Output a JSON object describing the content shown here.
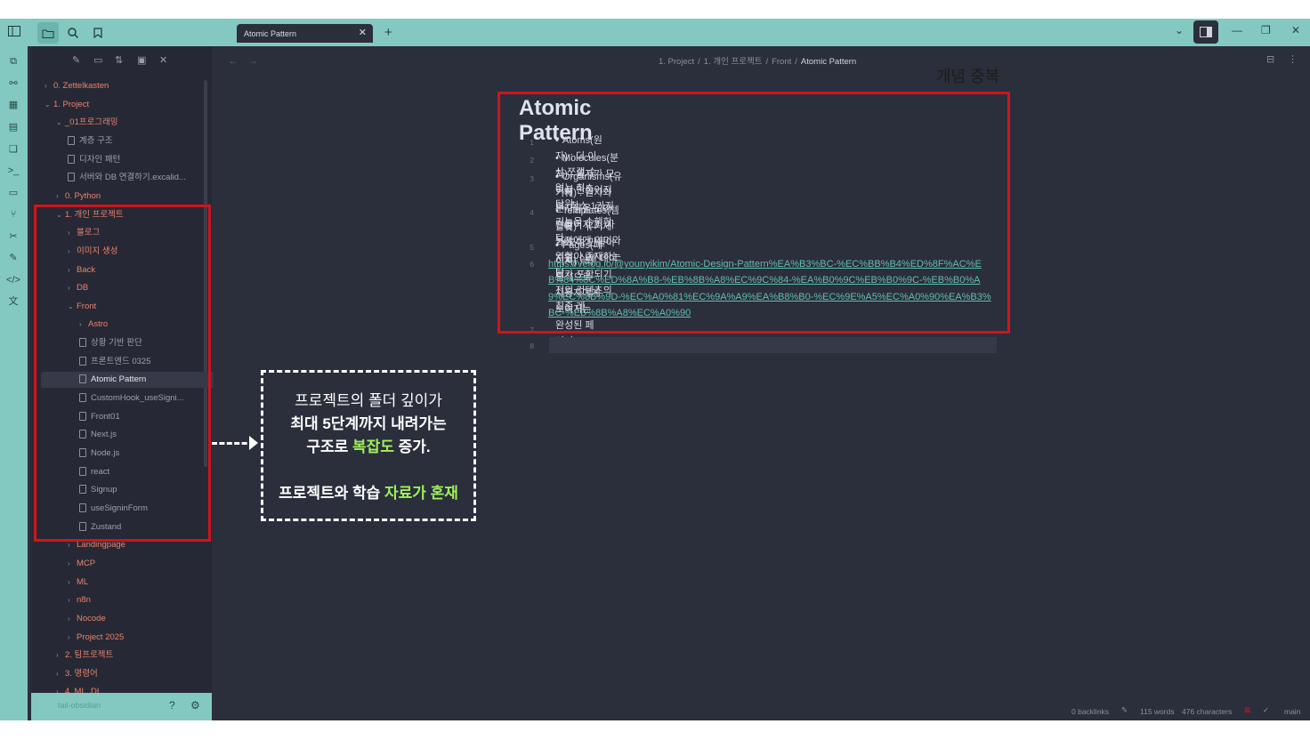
{
  "titlebar": {
    "tab_title": "Atomic Pattern",
    "tab_close": "✕",
    "new_tab": "+"
  },
  "breadcrumb": [
    "1. Project",
    "1. 개인 프로젝트",
    "Front",
    "Atomic Pattern"
  ],
  "sidebar": {
    "vault_name": "tail-obsidian",
    "items": [
      {
        "label": "0. Zettelkasten",
        "kind": "folder",
        "open": false,
        "depth": 1
      },
      {
        "label": "1. Project",
        "kind": "folder",
        "open": true,
        "depth": 1
      },
      {
        "label": "_01프로그래밍",
        "kind": "folder",
        "open": true,
        "depth": 2
      },
      {
        "label": "계층 구조",
        "kind": "file",
        "depth": 3
      },
      {
        "label": "디자인 패턴",
        "kind": "file",
        "depth": 3
      },
      {
        "label": "서버와 DB 연결하기.excalid...",
        "kind": "file",
        "depth": 3
      },
      {
        "label": "0. Python",
        "kind": "folder",
        "open": false,
        "depth": 2
      },
      {
        "label": "1. 개인 프로젝트",
        "kind": "folder",
        "open": true,
        "depth": 2
      },
      {
        "label": "블로그",
        "kind": "folder",
        "open": false,
        "depth": 3
      },
      {
        "label": "이미지 생성",
        "kind": "folder",
        "open": false,
        "depth": 3
      },
      {
        "label": "Back",
        "kind": "folder",
        "open": false,
        "depth": 3
      },
      {
        "label": "DB",
        "kind": "folder",
        "open": false,
        "depth": 3
      },
      {
        "label": "Front",
        "kind": "folder",
        "open": true,
        "depth": 3
      },
      {
        "label": "Astro",
        "kind": "folder",
        "open": false,
        "depth": 4
      },
      {
        "label": "상황 기반 판단",
        "kind": "file",
        "depth": 4
      },
      {
        "label": "프론트엔드 0325",
        "kind": "file",
        "depth": 4
      },
      {
        "label": "Atomic Pattern",
        "kind": "file",
        "depth": 4,
        "selected": true
      },
      {
        "label": "CustomHook_useSigni...",
        "kind": "file",
        "depth": 4
      },
      {
        "label": "Front01",
        "kind": "file",
        "depth": 4
      },
      {
        "label": "Next.js",
        "kind": "file",
        "depth": 4
      },
      {
        "label": "Node.js",
        "kind": "file",
        "depth": 4
      },
      {
        "label": "react",
        "kind": "file",
        "depth": 4
      },
      {
        "label": "Signup",
        "kind": "file",
        "depth": 4
      },
      {
        "label": "useSigninForm",
        "kind": "file",
        "depth": 4
      },
      {
        "label": "Zustand",
        "kind": "file",
        "depth": 4
      },
      {
        "label": "Landingpage",
        "kind": "folder",
        "open": false,
        "depth": 3
      },
      {
        "label": "MCP",
        "kind": "folder",
        "open": false,
        "depth": 3
      },
      {
        "label": "ML",
        "kind": "folder",
        "open": false,
        "depth": 3
      },
      {
        "label": "n8n",
        "kind": "folder",
        "open": false,
        "depth": 3
      },
      {
        "label": "Nocode",
        "kind": "folder",
        "open": false,
        "depth": 3
      },
      {
        "label": "Project 2025",
        "kind": "folder",
        "open": false,
        "depth": 3
      },
      {
        "label": "2. 팀프로젝트",
        "kind": "folder",
        "open": false,
        "depth": 2
      },
      {
        "label": "3. 명령어",
        "kind": "folder",
        "open": false,
        "depth": 2
      },
      {
        "label": "4. ML_DL",
        "kind": "folder",
        "open": false,
        "depth": 2
      }
    ]
  },
  "document": {
    "title": "Atomic Pattern",
    "line_numbers": [
      "1",
      "2",
      "3",
      "4",
      "5",
      "6",
      "7",
      "8"
    ],
    "bullets": [
      "Atoms(원자) : 더 이상 쪼갤 수 없는 최소 단위.",
      "Molecules(분자) : 원자가 모여서 만들어지며, 최소 1가지 기능을 수행한다.",
      "Organisms(유기체) : 원자와 분자들을 모아 만들어지고, 사용자에게 의미와 역할이 존재하는 단",
      "위",
      "Templates(템플릿) : 유기체가 모여 만들어지고, 실제 데이터가 포함되기 전의 컨텐츠의 최종 레",
      "이아웃",
      "Pages(페이지) : 최종적으로 사용자에게 보여지는 완성된 페이지"
    ],
    "link": "https://velog.io/@younyikim/Atomic-Design-Pattern%EA%B3%BC-%EC%BB%B4%ED%8F%AC%EB%84%8C%ED%8A%B8-%EB%8B%A8%EC%9C%84-%EA%B0%9C%EB%B0%9C-%EB%B0%A9%EC%8B%9D-%EC%A0%81%EC%9A%A9%EA%B8%B0-%EC%9E%A5%EC%A0%90%EA%B3%BC-%EB%8B%A8%EC%A0%90"
  },
  "status": {
    "backlinks": "0 backlinks",
    "words": "115 words",
    "chars": "476 characters",
    "branch": "main"
  },
  "annotations": {
    "concept_overlap": "개념 중복",
    "callout_line1": "프로젝트의 폴더 깊이가",
    "callout_line2": "최대 5단계까지 내려가는",
    "callout_line3_a": "구조로 ",
    "callout_line3_hl": "복잡도",
    "callout_line3_b": " 증가.",
    "callout_line4_a": "프로젝트와 학습 ",
    "callout_line4_hl": "자료가 혼재",
    "highlight_color": "#9ef05a",
    "box_color": "#d0141d"
  }
}
